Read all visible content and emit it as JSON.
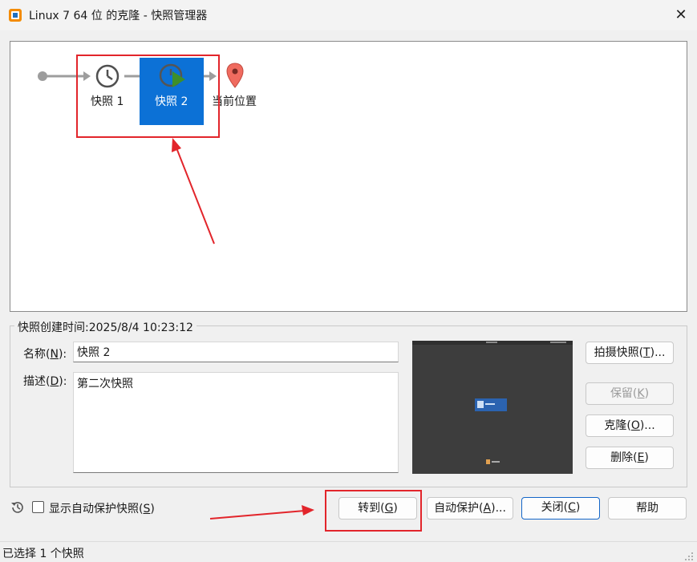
{
  "window": {
    "title": "Linux 7 64 位 的克隆 - 快照管理器",
    "close_glyph": "✕"
  },
  "tree": {
    "snapshots": [
      {
        "label": "快照 1",
        "selected": false
      },
      {
        "label": "快照 2",
        "selected": true
      }
    ],
    "current_label": "当前位置"
  },
  "details": {
    "created_caption": "快照创建时间:2025/8/4 10:23:12",
    "name_label_prefix": "名称(",
    "name_label_key": "N",
    "name_label_suffix": "):",
    "name_value": "快照 2",
    "desc_label_prefix": "描述(",
    "desc_label_key": "D",
    "desc_label_suffix": "):",
    "desc_value": "第二次快照"
  },
  "side_buttons": {
    "take": {
      "prefix": "拍摄快照(",
      "key": "T",
      "suffix": ")..."
    },
    "keep": {
      "prefix": "保留(",
      "key": "K",
      "suffix": ")"
    },
    "clone": {
      "prefix": "克隆(",
      "key": "O",
      "suffix": ")..."
    },
    "delete": {
      "prefix": "删除(",
      "key": "E",
      "suffix": ")"
    }
  },
  "bottom": {
    "show_auto_prefix": "显示自动保护快照(",
    "show_auto_key": "S",
    "show_auto_suffix": ")",
    "show_auto_checked": false,
    "goto": {
      "prefix": "转到(",
      "key": "G",
      "suffix": ")"
    },
    "autoprotect": {
      "prefix": "自动保护(",
      "key": "A",
      "suffix": ")..."
    },
    "close": {
      "prefix": "关闭(",
      "key": "C",
      "suffix": ")"
    },
    "help": "帮助"
  },
  "status": {
    "text": "已选择 1 个快照"
  },
  "colors": {
    "selection": "#0c71d6",
    "annotation_red": "#e2252b",
    "pin": "#f06b5f",
    "play": "#3f8f2a"
  }
}
